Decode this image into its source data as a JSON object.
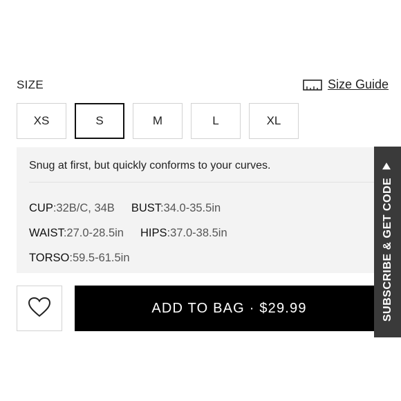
{
  "size_section": {
    "label": "SIZE",
    "guide_label": "Size Guide",
    "options": [
      "XS",
      "S",
      "M",
      "L",
      "XL"
    ],
    "selected": "S"
  },
  "info": {
    "fit_note": "Snug at first, but quickly conforms to your curves.",
    "cup_key": "CUP",
    "cup_val": ":32B/C, 34B",
    "bust_key": "BUST",
    "bust_val": ":34.0-35.5in",
    "waist_key": "WAIST",
    "waist_val": ":27.0-28.5in",
    "hips_key": "HIPS",
    "hips_val": ":37.0-38.5in",
    "torso_key": "TORSO",
    "torso_val": ":59.5-61.5in"
  },
  "actions": {
    "add_to_bag": "ADD TO BAG · $29.99",
    "wishlist_icon": "heart-icon"
  },
  "subscribe_tab": {
    "label": "SUBSCRIBE & GET CODE",
    "arrow_icon": "triangle-up-icon",
    "color": "#3a3a3a"
  }
}
